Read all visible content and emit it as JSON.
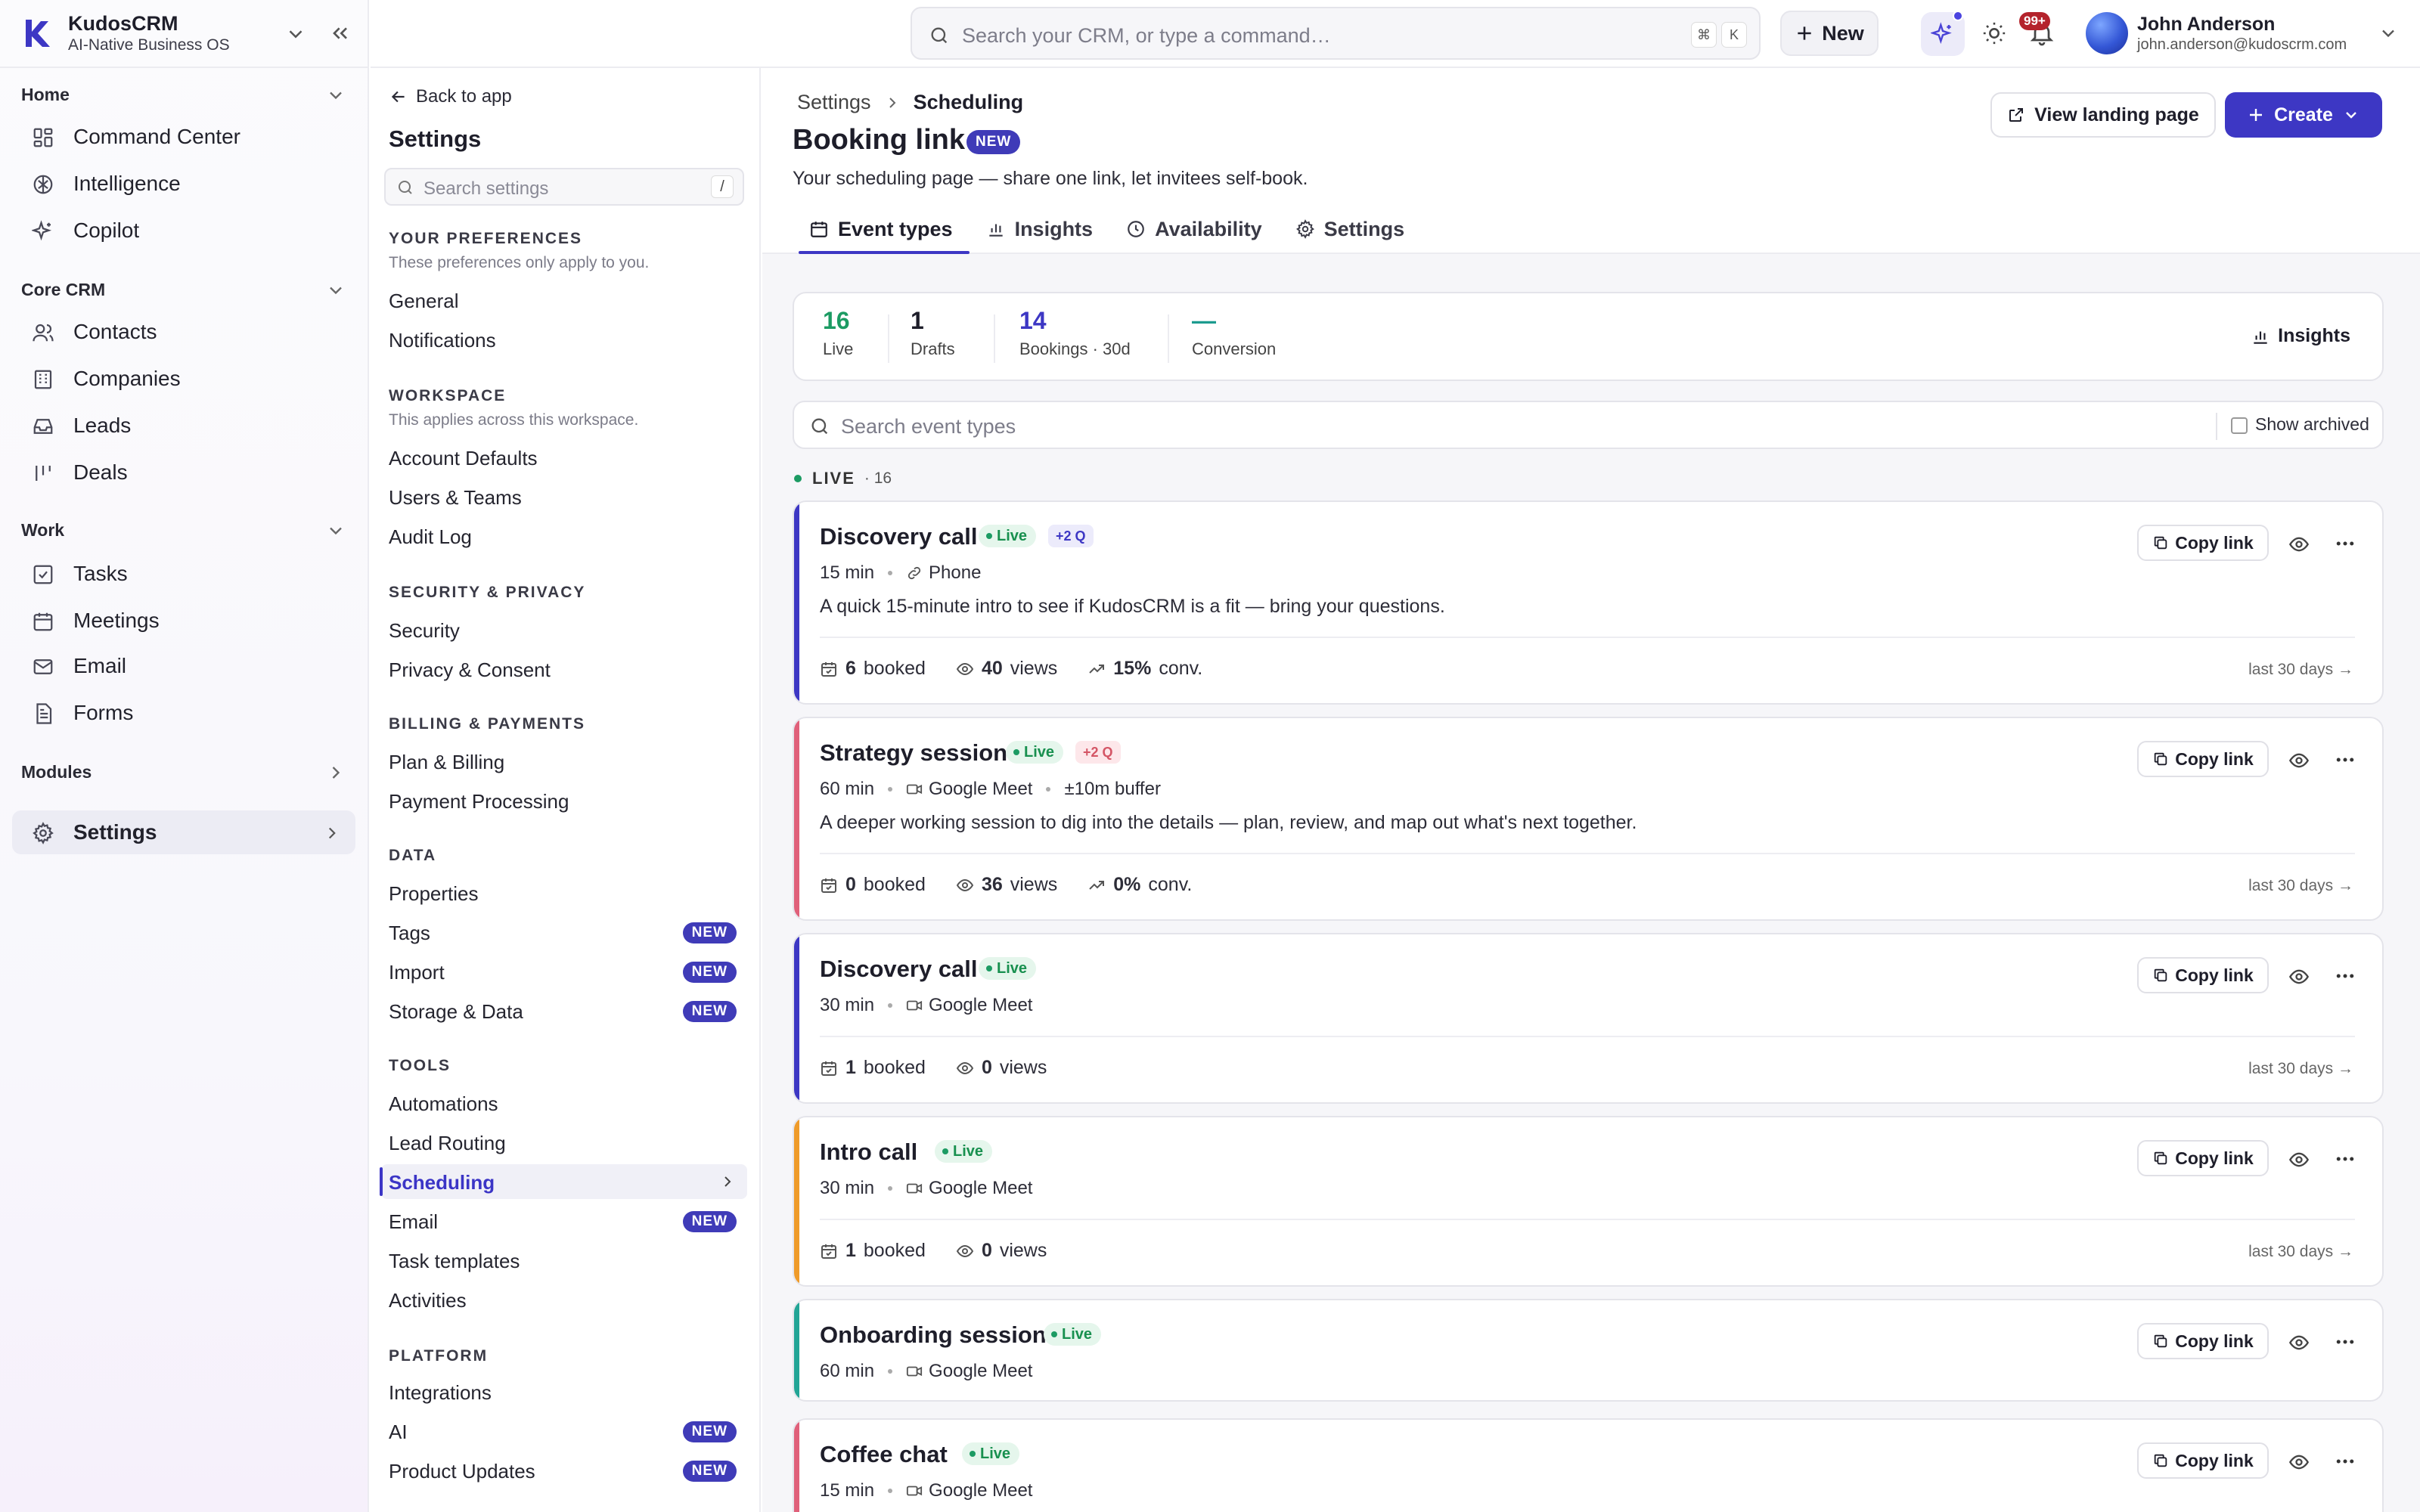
{
  "brand": {
    "name": "KudosCRM",
    "tagline": "AI-Native Business OS",
    "accent": "#3d37c4"
  },
  "nav": {
    "groups": [
      {
        "label": "Home",
        "items": [
          {
            "label": "Command Center",
            "icon": "grid-icon"
          },
          {
            "label": "Intelligence",
            "icon": "brain-icon"
          },
          {
            "label": "Copilot",
            "icon": "sparkle-icon"
          }
        ]
      },
      {
        "label": "Core CRM",
        "items": [
          {
            "label": "Contacts",
            "icon": "users-icon"
          },
          {
            "label": "Companies",
            "icon": "building-icon"
          },
          {
            "label": "Leads",
            "icon": "inbox-icon"
          },
          {
            "label": "Deals",
            "icon": "pipeline-icon"
          }
        ]
      },
      {
        "label": "Work",
        "items": [
          {
            "label": "Tasks",
            "icon": "checkbox-icon"
          },
          {
            "label": "Meetings",
            "icon": "calendar-icon"
          },
          {
            "label": "Email",
            "icon": "mail-icon"
          },
          {
            "label": "Forms",
            "icon": "form-icon"
          }
        ]
      },
      {
        "label": "Modules",
        "items": []
      }
    ],
    "settings_label": "Settings"
  },
  "topbar": {
    "search_placeholder": "Search your CRM, or type a command…",
    "kbd_mod": "⌘",
    "kbd_key": "K",
    "new_label": "New",
    "notif_count": "99+",
    "user_name": "John Anderson",
    "user_email": "john.anderson@kudoscrm.com"
  },
  "settings_nav": {
    "back_label": "Back to app",
    "title": "Settings",
    "search_placeholder": "Search settings",
    "search_kbd": "/",
    "new_badge": "NEW",
    "sections": [
      {
        "title": "YOUR PREFERENCES",
        "subtitle": "These preferences only apply to you.",
        "items": [
          {
            "label": "General"
          },
          {
            "label": "Notifications"
          }
        ]
      },
      {
        "title": "WORKSPACE",
        "subtitle": "This applies across this workspace.",
        "items": [
          {
            "label": "Account Defaults"
          },
          {
            "label": "Users & Teams"
          },
          {
            "label": "Audit Log"
          }
        ]
      },
      {
        "title": "SECURITY & PRIVACY",
        "items": [
          {
            "label": "Security"
          },
          {
            "label": "Privacy & Consent"
          }
        ]
      },
      {
        "title": "BILLING & PAYMENTS",
        "items": [
          {
            "label": "Plan & Billing"
          },
          {
            "label": "Payment Processing"
          }
        ]
      },
      {
        "title": "DATA",
        "items": [
          {
            "label": "Properties"
          },
          {
            "label": "Tags",
            "badge": true
          },
          {
            "label": "Import",
            "badge": true
          },
          {
            "label": "Storage & Data",
            "badge": true
          }
        ]
      },
      {
        "title": "TOOLS",
        "items": [
          {
            "label": "Automations"
          },
          {
            "label": "Lead Routing"
          },
          {
            "label": "Scheduling",
            "active": true
          },
          {
            "label": "Email",
            "badge": true
          },
          {
            "label": "Task templates"
          },
          {
            "label": "Activities"
          }
        ]
      },
      {
        "title": "PLATFORM",
        "items": [
          {
            "label": "Integrations"
          },
          {
            "label": "AI",
            "badge": true
          },
          {
            "label": "Product Updates",
            "badge": true
          }
        ]
      }
    ]
  },
  "page": {
    "breadcrumb_parent": "Settings",
    "breadcrumb_current": "Scheduling",
    "title": "Booking link",
    "title_badge": "NEW",
    "subtitle": "Your scheduling page — share one link, let invitees self-book.",
    "view_landing_label": "View landing page",
    "create_label": "Create",
    "tabs": [
      {
        "label": "Event types",
        "icon": "calendar-icon",
        "active": true
      },
      {
        "label": "Insights",
        "icon": "bar-chart-icon"
      },
      {
        "label": "Availability",
        "icon": "clock-icon"
      },
      {
        "label": "Settings",
        "icon": "gear-icon"
      }
    ],
    "stats": [
      {
        "value": "16",
        "label": "Live",
        "color": "#1c9b63"
      },
      {
        "value": "1",
        "label": "Drafts",
        "color": "#1e1e2a"
      },
      {
        "value": "14",
        "label": "Bookings · 30d",
        "color": "#3d37c4"
      },
      {
        "value": "—",
        "label": "Conversion",
        "color": "#1c9b8f"
      }
    ],
    "insights_label": "Insights",
    "event_search_placeholder": "Search event types",
    "show_archived_label": "Show archived",
    "live_header": "LIVE",
    "live_count": "· 16",
    "copy_label": "Copy link",
    "live_pill": "Live",
    "last30_label": "last 30 days →",
    "events": [
      {
        "title": "Discovery call",
        "q": "+2 Q",
        "q_style": "blue",
        "duration": "15 min",
        "location": "Phone",
        "loc_icon": "link-icon",
        "description": "A quick 15-minute intro to see if KudosCRM is a fit — bring your questions.",
        "booked": "6",
        "booked_label": "booked",
        "views": "40",
        "views_label": "views",
        "conv": "15%",
        "conv_label": "conv.",
        "accent": "#3d37c4"
      },
      {
        "title": "Strategy session",
        "q": "+2 Q",
        "q_style": "red",
        "duration": "60 min",
        "location": "Google Meet",
        "loc_icon": "video-icon",
        "buffer": "±10m buffer",
        "description": "A deeper working session to dig into the details — plan, review, and map out what's next together.",
        "booked": "0",
        "booked_label": "booked",
        "views": "36",
        "views_label": "views",
        "conv": "0%",
        "conv_label": "conv.",
        "accent": "#e0607a"
      },
      {
        "title": "Discovery call",
        "duration": "30 min",
        "location": "Google Meet",
        "loc_icon": "video-icon",
        "booked": "1",
        "booked_label": "booked",
        "views": "0",
        "views_label": "views",
        "accent": "#3d37c4"
      },
      {
        "title": "Intro call",
        "duration": "30 min",
        "location": "Google Meet",
        "loc_icon": "video-icon",
        "booked": "1",
        "booked_label": "booked",
        "views": "0",
        "views_label": "views",
        "accent": "#ef9b2a"
      },
      {
        "title": "Onboarding session",
        "duration": "60 min",
        "location": "Google Meet",
        "loc_icon": "video-icon",
        "accent": "#22a596"
      },
      {
        "title": "Coffee chat",
        "duration": "15 min",
        "location": "Google Meet",
        "loc_icon": "video-icon",
        "accent": "#e0607a"
      }
    ]
  }
}
